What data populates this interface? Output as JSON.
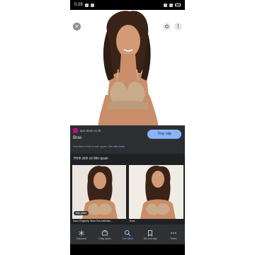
{
  "status_bar": {
    "time": "0:29"
  },
  "hero": {
    "close_icon": "close-icon",
    "lens_icon": "google-lens-icon",
    "more_icon": "more-vert-icon"
  },
  "result": {
    "site_domain": "qu1.avon.co.th",
    "title": "Bras",
    "copyright": "Hình ảnh có thể có bản quyền.",
    "learn_more": "Tìm hiểu thêm",
    "visit_button": "Truy cập"
  },
  "related": {
    "heading": "Hình ảnh có liên quan",
    "items": [
      {
        "caption": "Avon Flagship Store Bra Intimate...",
        "badge": "Sản phẩm"
      },
      {
        "caption": "Bras"
      }
    ]
  },
  "bottom_nav": {
    "items": [
      {
        "label": "Discover",
        "icon": "asterisk-icon"
      },
      {
        "label": "Tổng quan",
        "icon": "updates-icon"
      },
      {
        "label": "Tìm kiếm",
        "icon": "search-icon",
        "active": true
      },
      {
        "label": "Bộ sưu tập",
        "icon": "bookmark-icon"
      },
      {
        "label": "Thêm",
        "icon": "more-horiz-icon"
      }
    ]
  },
  "colors": {
    "accent": "#8ab4f8",
    "background": "#202124",
    "panel": "#2d2e31",
    "nav": "#303134",
    "favicon": "#b3127a"
  }
}
